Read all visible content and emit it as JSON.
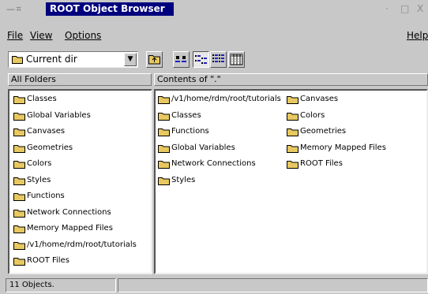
{
  "window": {
    "title": "ROOT Object Browser",
    "menu_glyph": "— ⌗",
    "minimize_glyph": "·",
    "maximize_glyph": "□",
    "close_glyph": "X"
  },
  "menubar": {
    "file": "File",
    "view": "View",
    "options": "Options",
    "help": "Help"
  },
  "toolbar": {
    "combo_value": "Current dir",
    "combo_arrow": "▼",
    "buttons": [
      "up-folder-icon",
      "large-icons-icon",
      "small-icons-icon",
      "list-icon",
      "details-icon"
    ]
  },
  "left_header": "All Folders",
  "right_header": "Contents of \".\"",
  "folder_tree": [
    "Classes",
    "Global Variables",
    "Canvases",
    "Geometries",
    "Colors",
    "Styles",
    "Functions",
    "Network Connections",
    "Memory Mapped Files",
    "/v1/home/rdm/root/tutorials",
    "ROOT Files"
  ],
  "contents": {
    "column1": [
      "/v1/home/rdm/root/tutorials",
      "Classes",
      "Functions",
      "Global Variables",
      "Network Connections",
      "Styles"
    ],
    "column2": [
      "Canvases",
      "Colors",
      "Geometries",
      "Memory Mapped Files",
      "ROOT Files"
    ]
  },
  "status": {
    "count": "11 Objects.",
    "extra": ""
  },
  "colors": {
    "title_bg": "#00007e",
    "folder": "#e8c860",
    "window_bg": "#c8c8c8"
  }
}
